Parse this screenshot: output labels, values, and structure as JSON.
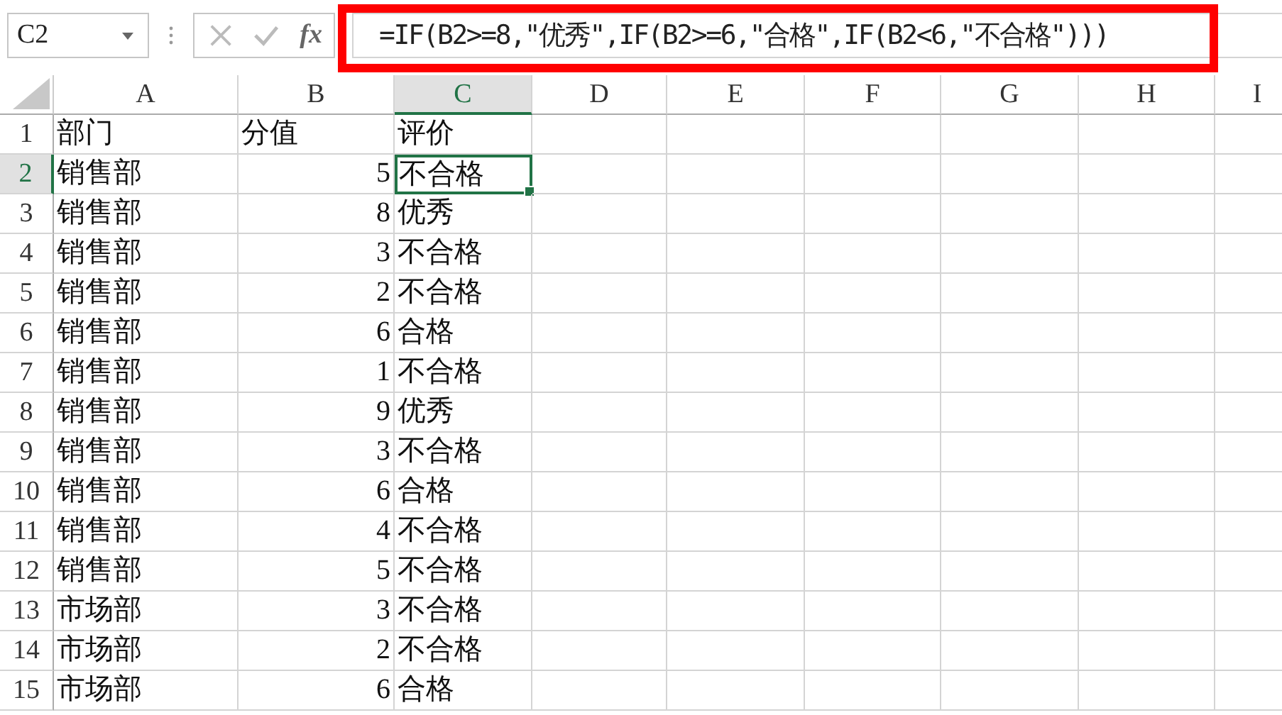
{
  "name_box": "C2",
  "function_button": "fx",
  "formula": "=IF(B2>=8,\"优秀\",IF(B2>=6,\"合格\",IF(B2<6,\"不合格\")))",
  "columns": [
    {
      "label": "A",
      "selected": false
    },
    {
      "label": "B",
      "selected": false
    },
    {
      "label": "C",
      "selected": true
    },
    {
      "label": "D",
      "selected": false
    },
    {
      "label": "E",
      "selected": false
    },
    {
      "label": "F",
      "selected": false
    },
    {
      "label": "G",
      "selected": false
    },
    {
      "label": "H",
      "selected": false
    },
    {
      "label": "I",
      "selected": false
    }
  ],
  "rows": [
    {
      "number": "1",
      "selected": false,
      "cells": [
        "部门",
        "分值",
        "评价"
      ]
    },
    {
      "number": "2",
      "selected": true,
      "cells": [
        "销售部",
        "5",
        "不合格"
      ]
    },
    {
      "number": "3",
      "selected": false,
      "cells": [
        "销售部",
        "8",
        "优秀"
      ]
    },
    {
      "number": "4",
      "selected": false,
      "cells": [
        "销售部",
        "3",
        "不合格"
      ]
    },
    {
      "number": "5",
      "selected": false,
      "cells": [
        "销售部",
        "2",
        "不合格"
      ]
    },
    {
      "number": "6",
      "selected": false,
      "cells": [
        "销售部",
        "6",
        "合格"
      ]
    },
    {
      "number": "7",
      "selected": false,
      "cells": [
        "销售部",
        "1",
        "不合格"
      ]
    },
    {
      "number": "8",
      "selected": false,
      "cells": [
        "销售部",
        "9",
        "优秀"
      ]
    },
    {
      "number": "9",
      "selected": false,
      "cells": [
        "销售部",
        "3",
        "不合格"
      ]
    },
    {
      "number": "10",
      "selected": false,
      "cells": [
        "销售部",
        "6",
        "合格"
      ]
    },
    {
      "number": "11",
      "selected": false,
      "cells": [
        "销售部",
        "4",
        "不合格"
      ]
    },
    {
      "number": "12",
      "selected": false,
      "cells": [
        "销售部",
        "5",
        "不合格"
      ]
    },
    {
      "number": "13",
      "selected": false,
      "cells": [
        "市场部",
        "3",
        "不合格"
      ]
    },
    {
      "number": "14",
      "selected": false,
      "cells": [
        "市场部",
        "2",
        "不合格"
      ]
    },
    {
      "number": "15",
      "selected": false,
      "cells": [
        "市场部",
        "6",
        "合格"
      ]
    }
  ]
}
